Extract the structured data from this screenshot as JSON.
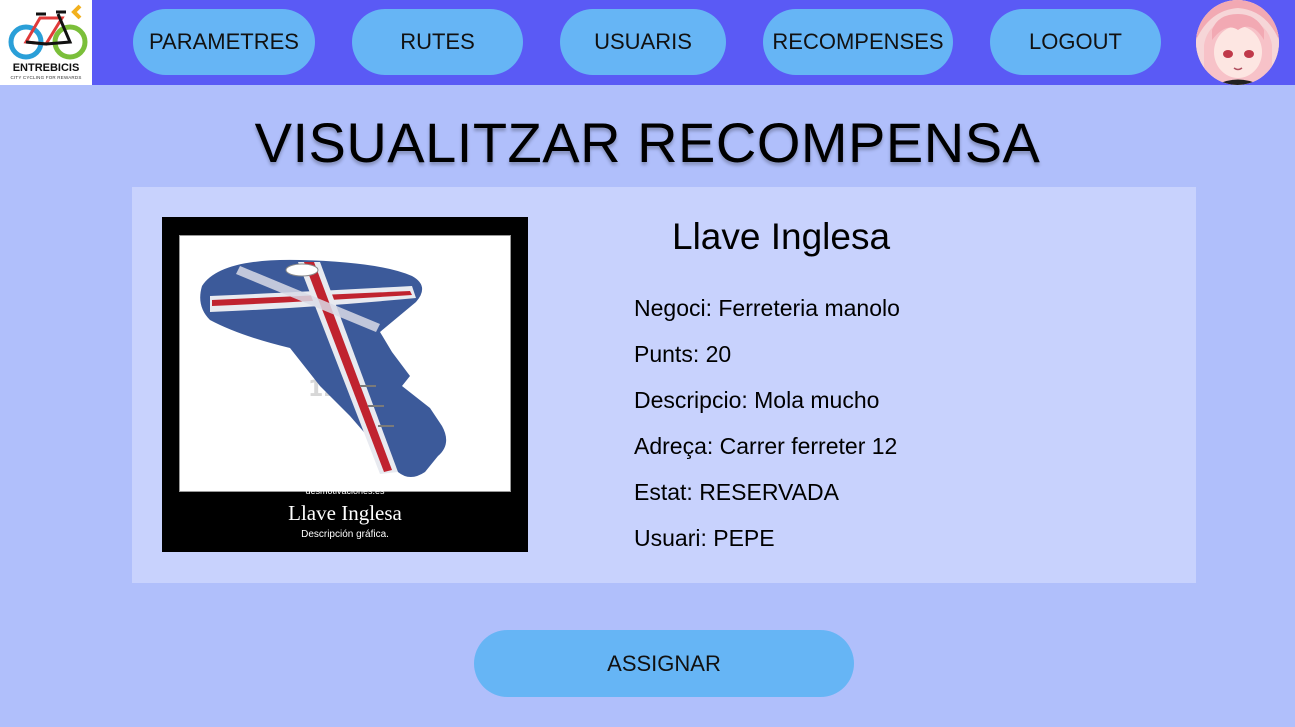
{
  "brand": {
    "name": "ENTREBICIS",
    "tagline": "CITY CYCLING FOR REWARDS"
  },
  "nav": {
    "parametres": "PARAMETRES",
    "rutes": "RUTES",
    "usuaris": "USUARIS",
    "recompenses": "RECOMPENSES",
    "logout": "LOGOUT"
  },
  "page": {
    "title": "VISUALITZAR RECOMPENSA"
  },
  "reward": {
    "name": "Llave Inglesa",
    "image": {
      "site": "desmotivaciones.es",
      "caption": "Llave Inglesa",
      "subcaption": "Descripción gráfica.",
      "watermark": "123RF"
    },
    "fields": {
      "negoci": "Negoci:  Ferreteria manolo",
      "punts": "Punts: 20",
      "descripcio": "Descripcio: Mola mucho",
      "adreca": "Adreça: Carrer ferreter 12",
      "estat": "Estat: RESERVADA",
      "usuari": "Usuari: PEPE"
    }
  },
  "actions": {
    "assign_label": "ASSIGNAR"
  },
  "icons": {
    "logo": "bicycle-logo-icon",
    "avatar": "user-avatar"
  },
  "colors": {
    "topbar": "#5a5af5",
    "nav_button": "#66b5f5",
    "page_background": "#b0bffb",
    "card_background": "#c8d2fd"
  }
}
